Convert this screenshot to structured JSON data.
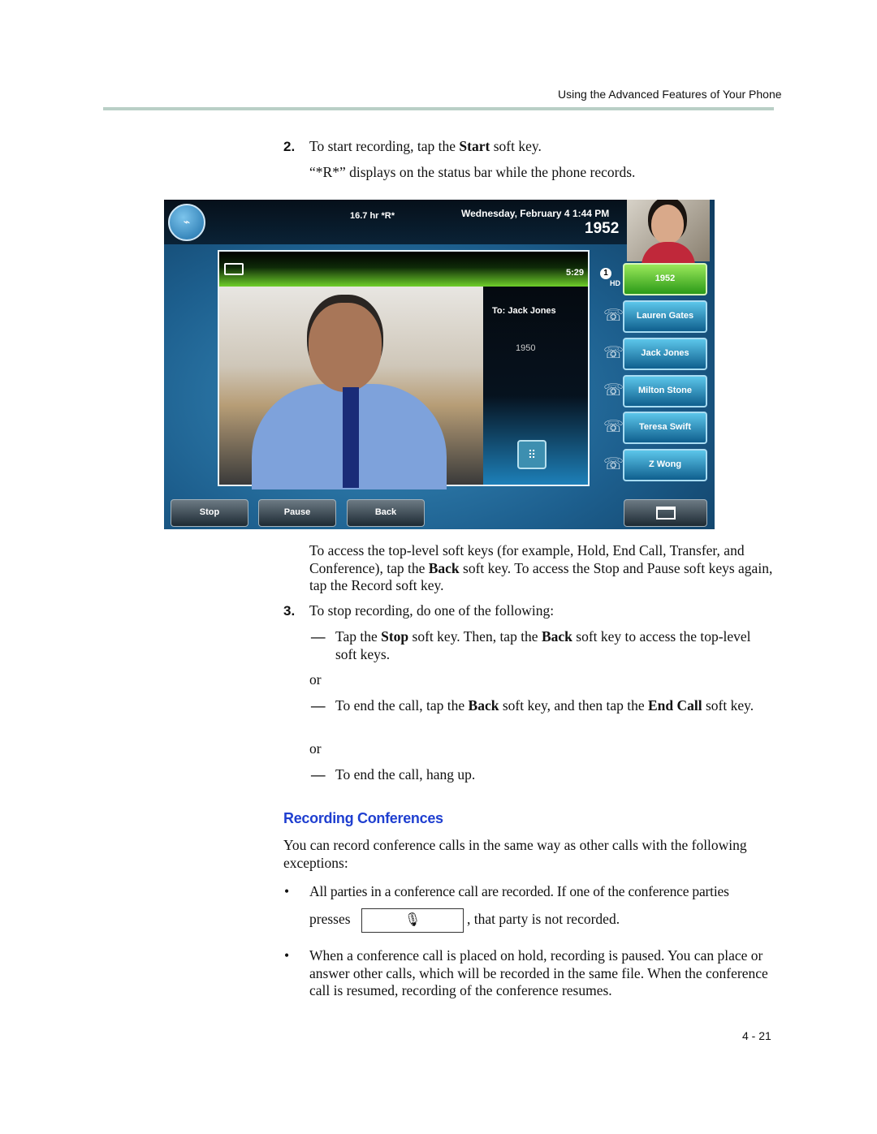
{
  "header": "Using the Advanced Features of Your Phone",
  "step2": {
    "num": "2.",
    "text": [
      {
        "t": "To start recording, tap the "
      },
      {
        "t": "Start",
        "b": 1
      },
      {
        "t": " soft key."
      }
    ],
    "note": "“*R*” displays on the status bar while the phone records."
  },
  "phone": {
    "usb_icon": "usb-icon",
    "status": "16.7 hr  *R*",
    "datetime": "Wednesday, February 4  1:44 PM",
    "ext": "1952",
    "timer": "5:29",
    "to": "To: Jack Jones",
    "number": "1950",
    "line_badge": "1",
    "hd": "HD",
    "lines": [
      "1952",
      "Lauren Gates",
      "Jack Jones",
      "Milton Stone",
      "Teresa Swift",
      "Z Wong"
    ],
    "softkeys": [
      "Stop",
      "Pause",
      "Back"
    ]
  },
  "para1": [
    {
      "t": "To access the top-level soft keys (for example, Hold, End Call, Transfer, and Conference), tap the "
    },
    {
      "t": "Back",
      "b": 1
    },
    {
      "t": " soft key. To access the Stop and Pause soft keys again, tap the Record soft key."
    }
  ],
  "step3": {
    "num": "3.",
    "text": "To stop recording, do one of the following:"
  },
  "dash": "—",
  "opt1": [
    {
      "t": "Tap the "
    },
    {
      "t": "Stop",
      "b": 1
    },
    {
      "t": " soft key. Then, tap the "
    },
    {
      "t": "Back",
      "b": 1
    },
    {
      "t": " soft key to access the top-level soft keys."
    }
  ],
  "or": "or",
  "opt2": [
    {
      "t": "To end the call, tap the "
    },
    {
      "t": "Back",
      "b": 1
    },
    {
      "t": " soft key, and then tap the "
    },
    {
      "t": "End Call",
      "b": 1
    },
    {
      "t": " soft key."
    }
  ],
  "opt3": "To end the call, hang up.",
  "section": {
    "title": "Recording Conferences",
    "intro": "You can record conference calls in the same way as other calls with the following exceptions:"
  },
  "bullet": "•",
  "b1a": "All parties in a conference call are recorded. If one of the conference parties",
  "b1b_pre": "presses",
  "b1b_post": ", that party is not recorded.",
  "mute_icon": "microphone-mute-icon",
  "b2": "When a conference call is placed on hold, recording is paused. You can place or answer other calls, which will be recorded in the same file. When the conference call is resumed, recording of the conference resumes.",
  "page_number": "4 - 21"
}
